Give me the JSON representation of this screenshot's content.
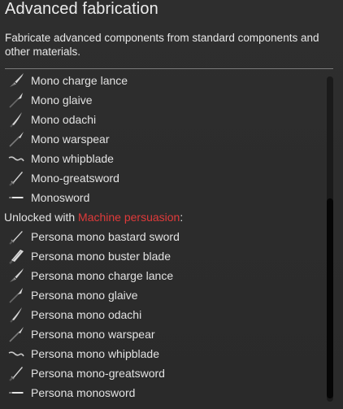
{
  "header": {
    "title": "Advanced fabrication",
    "description": "Fabricate advanced components from standard components and other materials."
  },
  "list": {
    "items_before": [
      {
        "label": "Mono charge lance",
        "icon": "lance-icon"
      },
      {
        "label": "Mono glaive",
        "icon": "glaive-icon"
      },
      {
        "label": "Mono odachi",
        "icon": "odachi-icon"
      },
      {
        "label": "Mono warspear",
        "icon": "spear-icon"
      },
      {
        "label": "Mono whipblade",
        "icon": "whipblade-icon"
      },
      {
        "label": "Mono-greatsword",
        "icon": "greatsword-icon"
      },
      {
        "label": "Monosword",
        "icon": "sword-icon"
      }
    ],
    "section": {
      "prefix": "Unlocked with ",
      "highlight": "Machine persuasion",
      "suffix": ":"
    },
    "items_after": [
      {
        "label": "Persona mono bastard sword",
        "icon": "bastard-sword-icon"
      },
      {
        "label": "Persona mono buster blade",
        "icon": "buster-blade-icon"
      },
      {
        "label": "Persona mono charge lance",
        "icon": "lance-icon"
      },
      {
        "label": "Persona mono glaive",
        "icon": "glaive-icon"
      },
      {
        "label": "Persona mono odachi",
        "icon": "odachi-icon"
      },
      {
        "label": "Persona mono warspear",
        "icon": "spear-icon"
      },
      {
        "label": "Persona mono whipblade",
        "icon": "whipblade-icon"
      },
      {
        "label": "Persona mono-greatsword",
        "icon": "greatsword-icon"
      },
      {
        "label": "Persona monosword",
        "icon": "sword-icon"
      }
    ]
  },
  "colors": {
    "background": "#2b2b2b",
    "text": "#e2e2e2",
    "highlight": "#e03a3a",
    "scroll_thumb": "#050505"
  }
}
